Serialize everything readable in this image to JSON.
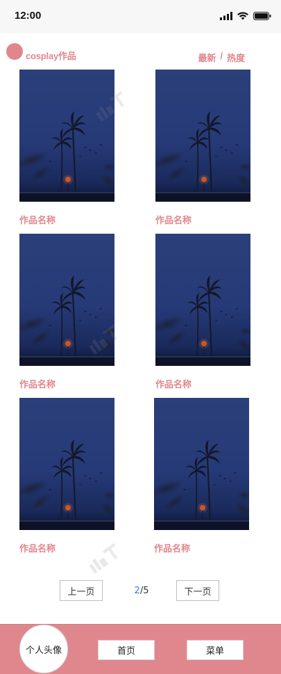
{
  "status_bar": {
    "time": "12:00",
    "icons": [
      "signal-icon",
      "wifi-icon",
      "battery-icon"
    ]
  },
  "header": {
    "title": "cosplay作品",
    "sort_latest": "最新",
    "sort_separator": "/",
    "sort_hot": "热度"
  },
  "works": [
    {
      "title": "作品名称"
    },
    {
      "title": "作品名称"
    },
    {
      "title": "作品名称"
    },
    {
      "title": "作品名称"
    },
    {
      "title": "作品名称"
    },
    {
      "title": "作品名称"
    }
  ],
  "pagination": {
    "prev_label": "上一页",
    "current_page": "2",
    "total_label": "/5",
    "next_label": "下一页"
  },
  "bottom_nav": {
    "profile_label": "个人头像",
    "home_label": "首页",
    "menu_label": "菜单"
  },
  "colors": {
    "accent": "#e0878e",
    "page_current": "#2b7de0"
  }
}
